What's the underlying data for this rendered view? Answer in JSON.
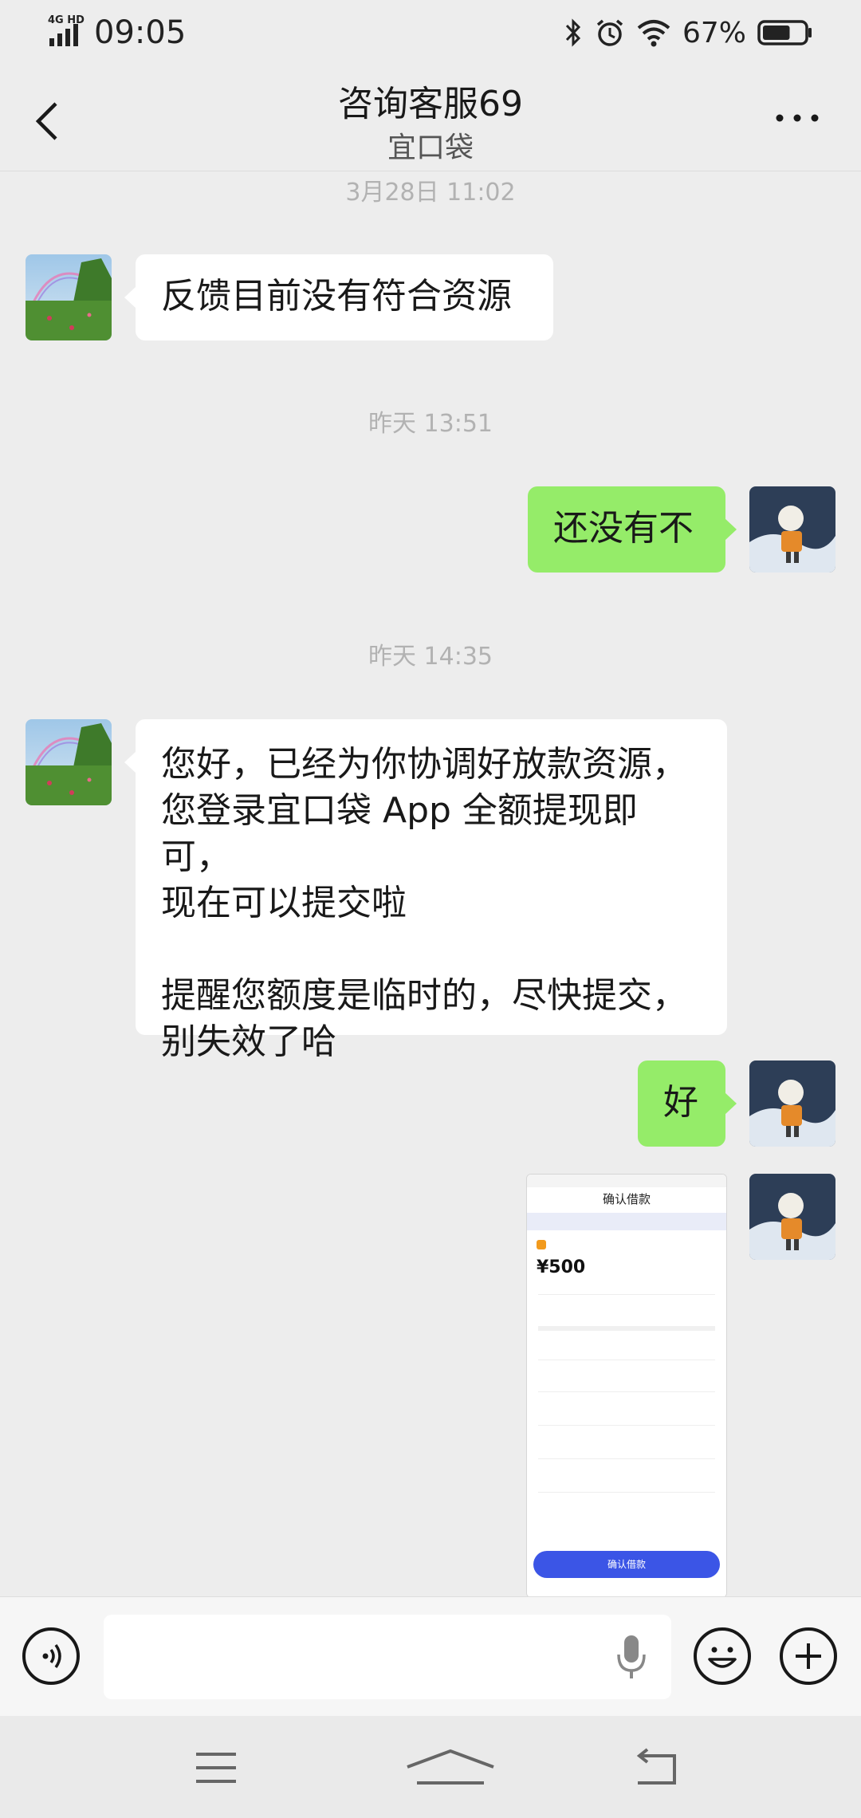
{
  "status_bar": {
    "network": "4G HD",
    "time": "09:05",
    "battery_text": "67%",
    "battery_level": 0.67,
    "icons": [
      "signal-icon",
      "bluetooth-icon",
      "alarm-icon",
      "wifi-icon",
      "battery-icon"
    ]
  },
  "header": {
    "title": "咨询客服69",
    "subtitle": "宜口袋",
    "icons": [
      "back-arrow-icon",
      "more-dots-icon"
    ]
  },
  "chat": {
    "messages": [
      {
        "type": "timestamp",
        "text": "3月28日 11:02"
      },
      {
        "type": "incoming",
        "text": "反馈目前没有符合资源"
      },
      {
        "type": "timestamp",
        "text": "昨天 13:51"
      },
      {
        "type": "outgoing",
        "text": "还没有不"
      },
      {
        "type": "timestamp",
        "text": "昨天 14:35"
      },
      {
        "type": "incoming",
        "lines": [
          "您好，已经为你协调好放款资源，",
          "您登录宜口袋 App 全额提现即可，",
          "现在可以提交啦",
          "",
          "提醒您额度是临时的，尽快提交，",
          "别失效了哈"
        ]
      },
      {
        "type": "outgoing",
        "text": "好"
      },
      {
        "type": "outgoing-image",
        "image": {
          "title": "确认借款",
          "amount": "¥500",
          "button": "确认借款"
        }
      }
    ]
  },
  "input_bar": {
    "value": "",
    "icons": [
      "voice-icon",
      "mic-icon",
      "emoji-icon",
      "plus-icon"
    ]
  },
  "system_nav": {
    "icons": [
      "menu-icon",
      "home-icon",
      "back-icon"
    ]
  },
  "colors": {
    "background": "#ededed",
    "outgoing_bubble": "#95ec69",
    "incoming_bubble": "#ffffff",
    "timestamp": "#b2b2b2",
    "confirm_button": "#3b55e6"
  }
}
